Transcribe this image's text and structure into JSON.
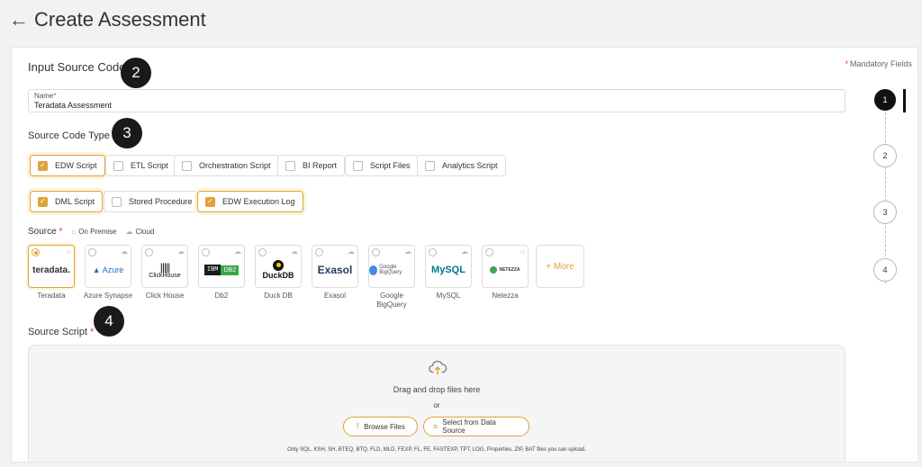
{
  "header": {
    "back_icon": "arrow-left-icon",
    "title": "Create Assessment"
  },
  "form": {
    "section_title": "Input Source Code",
    "mandatory_asterisk": "*",
    "mandatory_label": "Mandatory Fields",
    "name_label": "Name",
    "name_value": "Teradata Assessment",
    "source_code_type_label": "Source Code Type",
    "source_code_types": [
      {
        "label": "EDW Script",
        "checked": true
      },
      {
        "label": "ETL Script",
        "checked": false
      },
      {
        "label": "Orchestration Script",
        "checked": false
      },
      {
        "label": "BI Report",
        "checked": false
      },
      {
        "label": "Script Files",
        "checked": false
      },
      {
        "label": "Analytics Script",
        "checked": false
      },
      {
        "label": "DML Script",
        "checked": true
      },
      {
        "label": "Stored Procedure",
        "checked": false
      },
      {
        "label": "EDW Execution Log",
        "checked": true
      }
    ],
    "source_label": "Source",
    "legend_on_premise": "On Premise",
    "legend_cloud": "Cloud",
    "sources": [
      {
        "name": "Teradata",
        "logo_text": "teradata.",
        "selected": true,
        "location": "on-premise"
      },
      {
        "name": "Azure Synapse",
        "logo_text": "Azure",
        "selected": false,
        "location": "cloud"
      },
      {
        "name": "Click House",
        "logo_text": "ClickHouse",
        "selected": false,
        "location": "cloud"
      },
      {
        "name": "Db2",
        "logo_text": "IBM DB2",
        "selected": false,
        "location": "cloud"
      },
      {
        "name": "Duck DB",
        "logo_text": "DuckDB",
        "selected": false,
        "location": "cloud"
      },
      {
        "name": "Exasol",
        "logo_text": "Exasol",
        "selected": false,
        "location": "cloud"
      },
      {
        "name": "Google BigQuery",
        "logo_text": "Google BigQuery",
        "selected": false,
        "location": "cloud"
      },
      {
        "name": "MySQL",
        "logo_text": "MySQL",
        "selected": false,
        "location": "cloud"
      },
      {
        "name": "Netezza",
        "logo_text": "NETEZZA",
        "selected": false,
        "location": "on-premise"
      }
    ],
    "more_label": "+ More",
    "source_script_label": "Source Script",
    "dropzone": {
      "icon": "cloud-upload-icon",
      "drag_text": "Drag and drop files here",
      "or_text": "or",
      "browse_label": "Browse Files",
      "select_label": "Select from Data Source",
      "note": "Only SQL, KSH, SH, BTEQ, BTQ, FLD, MLD, FEXP, FL, FE, FASTEXP, TPT, LOG, Properties, ZIP, BAT files you can upload."
    }
  },
  "callouts": [
    "2",
    "3",
    "4"
  ],
  "stepper": {
    "steps": [
      "1",
      "2",
      "3",
      "4"
    ],
    "active": "1"
  },
  "colors": {
    "accent": "#e0a23a",
    "required": "#e03a3a",
    "callout": "#1a1a1a"
  }
}
